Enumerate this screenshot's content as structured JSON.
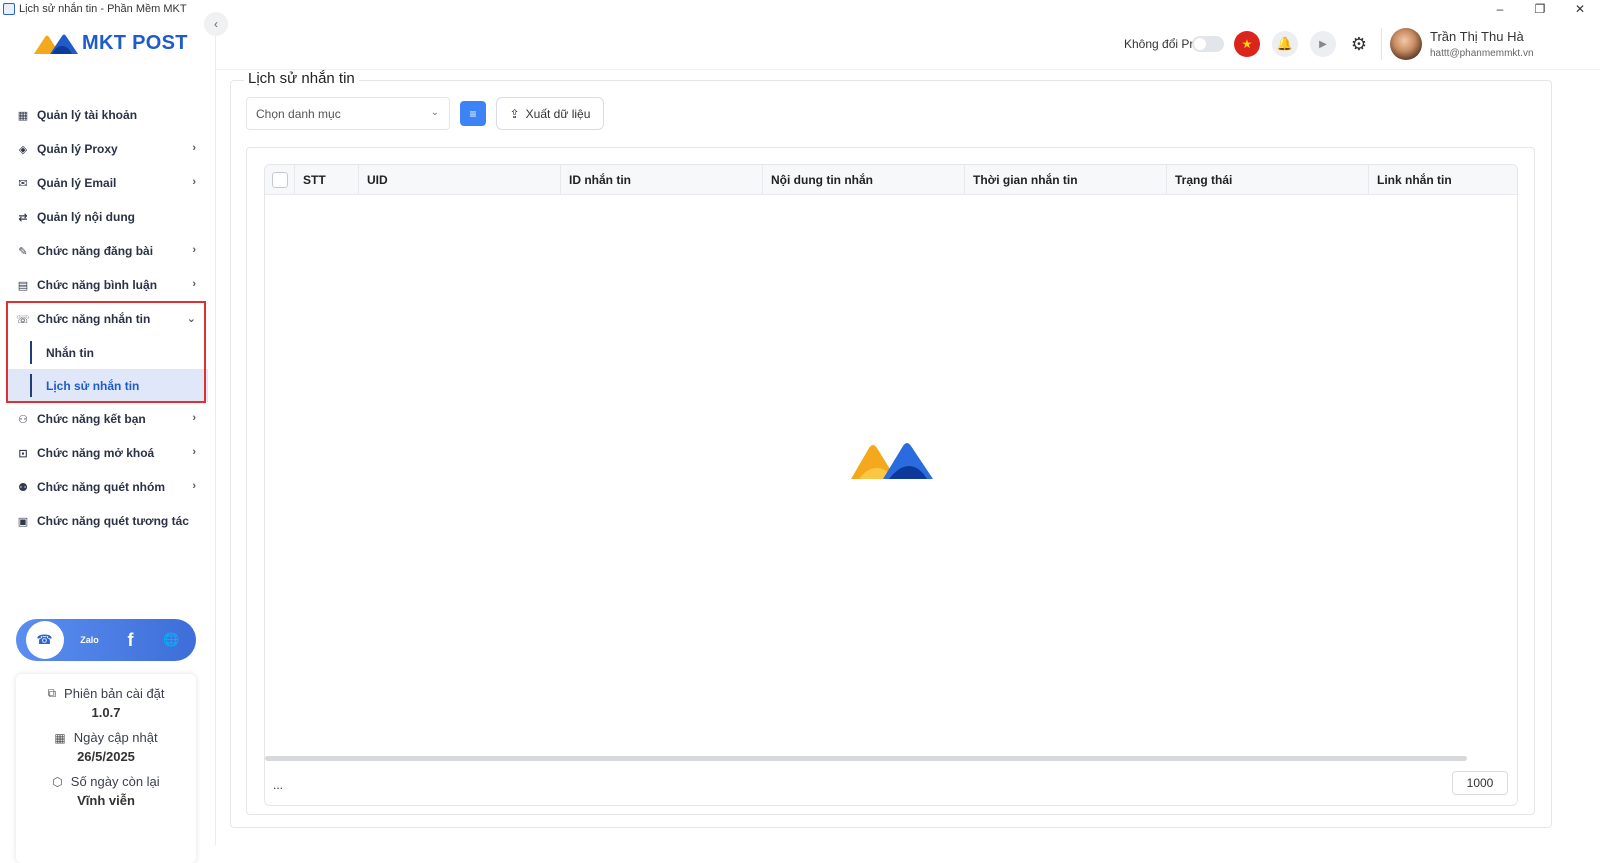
{
  "window": {
    "title": "Lịch sử nhắn tin - Phần Mềm MKT",
    "controls": [
      "–",
      "❐",
      "✕"
    ]
  },
  "brand": {
    "name": "MKT POST"
  },
  "sidebar": {
    "items": [
      {
        "label": "Quản lý tài khoản",
        "icon": "dashboard-icon",
        "glyph": "▦",
        "has_children": false
      },
      {
        "label": "Quản lý Proxy",
        "icon": "layers-icon",
        "glyph": "◈",
        "has_children": true
      },
      {
        "label": "Quản lý Email",
        "icon": "mail-icon",
        "glyph": "✉",
        "has_children": true
      },
      {
        "label": "Quản lý nội dung",
        "icon": "swap-icon",
        "glyph": "⇄",
        "has_children": false
      },
      {
        "label": "Chức năng đăng bài",
        "icon": "edit-post-icon",
        "glyph": "✎",
        "has_children": true
      },
      {
        "label": "Chức năng bình luận",
        "icon": "comment-icon",
        "glyph": "▤",
        "has_children": true
      },
      {
        "label": "Chức năng nhắn tin",
        "icon": "chat-icon",
        "glyph": "☏",
        "has_children": true,
        "expanded": true,
        "children": [
          {
            "label": "Nhắn tin",
            "active": false
          },
          {
            "label": "Lịch sử nhắn tin",
            "active": true
          }
        ]
      },
      {
        "label": "Chức năng kết bạn",
        "icon": "add-friend-icon",
        "glyph": "⚇",
        "has_children": true
      },
      {
        "label": "Chức năng mở khoá",
        "icon": "unlock-icon",
        "glyph": "⊡",
        "has_children": true
      },
      {
        "label": "Chức năng quét nhóm",
        "icon": "group-icon",
        "glyph": "⚉",
        "has_children": true
      },
      {
        "label": "Chức năng quét tương tác",
        "icon": "scan-icon",
        "glyph": "▣",
        "has_children": false
      }
    ],
    "social": [
      {
        "name": "support-icon",
        "glyph": "☎"
      },
      {
        "name": "zalo-icon",
        "glyph": "Zalo"
      },
      {
        "name": "facebook-icon",
        "glyph": "f"
      },
      {
        "name": "globe-icon",
        "glyph": "🌐"
      }
    ],
    "info": {
      "version_label": "Phiên bản cài đặt",
      "version_value": "1.0.7",
      "update_label": "Ngày cập nhật",
      "update_value": "26/5/2025",
      "remaining_label": "Số ngày còn lại",
      "remaining_value": "Vĩnh viễn"
    }
  },
  "header": {
    "proxy_label": "Không đổi Proxy",
    "proxy_toggle_on": false,
    "flag_glyph": "★",
    "bell_glyph": "🔔",
    "play_glyph": "▶",
    "gear_glyph": "⚙",
    "user_name": "Trần Thị Thu Hà",
    "user_email": "hattt@phanmemmkt.vn"
  },
  "main": {
    "title": "Lịch sử nhắn tin",
    "category_placeholder": "Chọn danh mục",
    "filter_glyph": "≡",
    "export_label": "Xuất dữ liệu",
    "export_glyph": "⇪",
    "table": {
      "columns": [
        "STT",
        "UID",
        "ID nhắn tin",
        "Nội dung tin nhắn",
        "Thời gian nhắn tin",
        "Trạng thái",
        "Link nhắn tin"
      ],
      "rows": []
    },
    "footer_text": "...",
    "page_size": "1000"
  },
  "colors": {
    "accent": "#1f5bc9",
    "filter_button": "#3d83f5",
    "highlight_border": "#e03131",
    "active_menu_bg": "#dfe7f9"
  }
}
